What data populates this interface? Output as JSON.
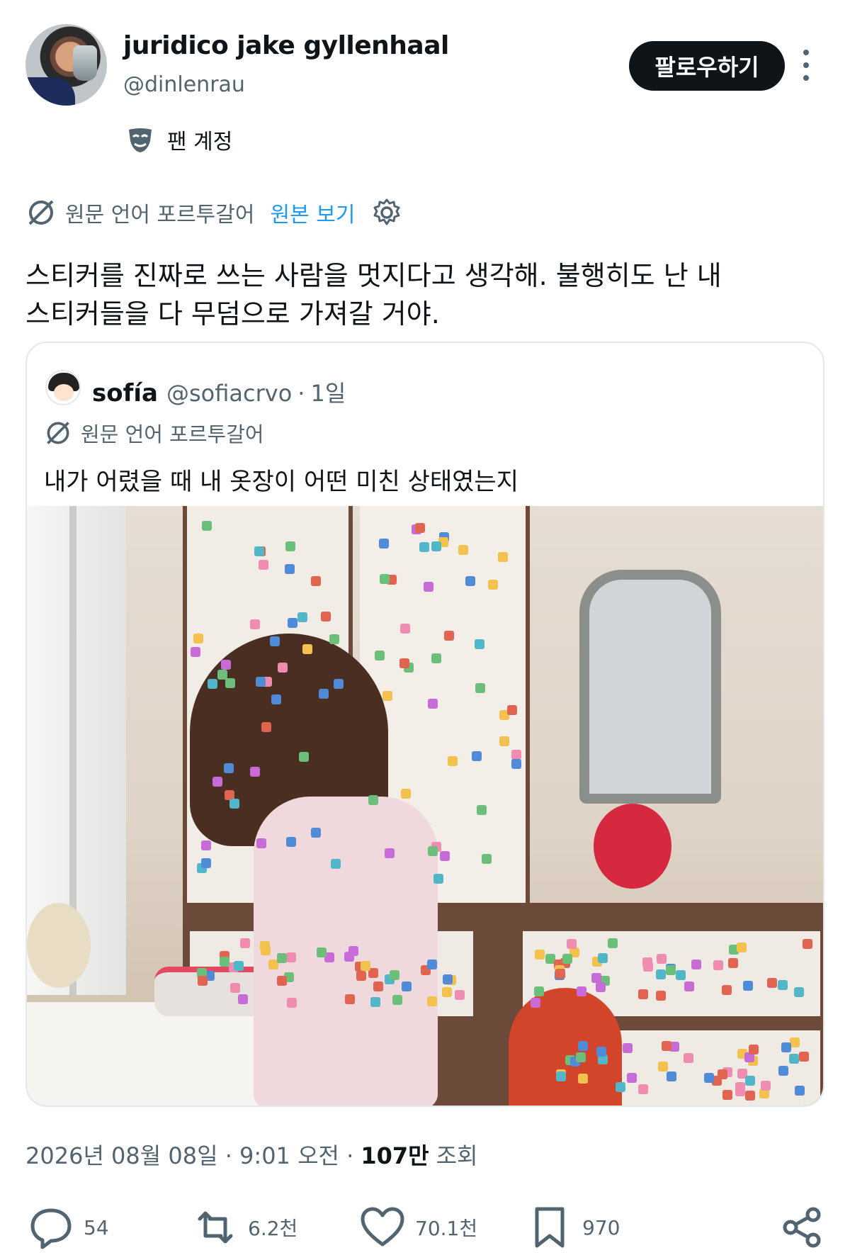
{
  "author": {
    "display_name": "juridico jake gyllenhaal",
    "handle": "@dinlenrau",
    "follow_label": "팔로우하기",
    "fan_account_label": "팬 계정"
  },
  "translation": {
    "label": "원문 언어 포르투갈어",
    "view_original": "원본 보기"
  },
  "tweet": {
    "line1": "스티커를 진짜로 쓰는 사람을 멋지다고 생각해. 불행히도 난 내",
    "line2": "스티커들을 다 무덤으로 가져갈 거야."
  },
  "quote": {
    "name": "sofía",
    "handle": "@sofiacrvo",
    "separator": "·",
    "time": "1일",
    "translation_label": "원문 언어 포르투갈어",
    "text": "내가 어렸을 때 내 옷장이 어떤 미친 상태였는지"
  },
  "meta": {
    "timestamp": "2026년 08월 08일 · 9:01 오전 ·",
    "views_count": "107만",
    "views_label": "조회"
  },
  "actions": {
    "replies": "54",
    "reposts": "6.2천",
    "likes": "70.1천",
    "bookmarks": "970"
  },
  "colors": {
    "text": "#0f1419",
    "secondary": "#536471",
    "link": "#1d9bf0",
    "border": "#e6e9eb"
  }
}
